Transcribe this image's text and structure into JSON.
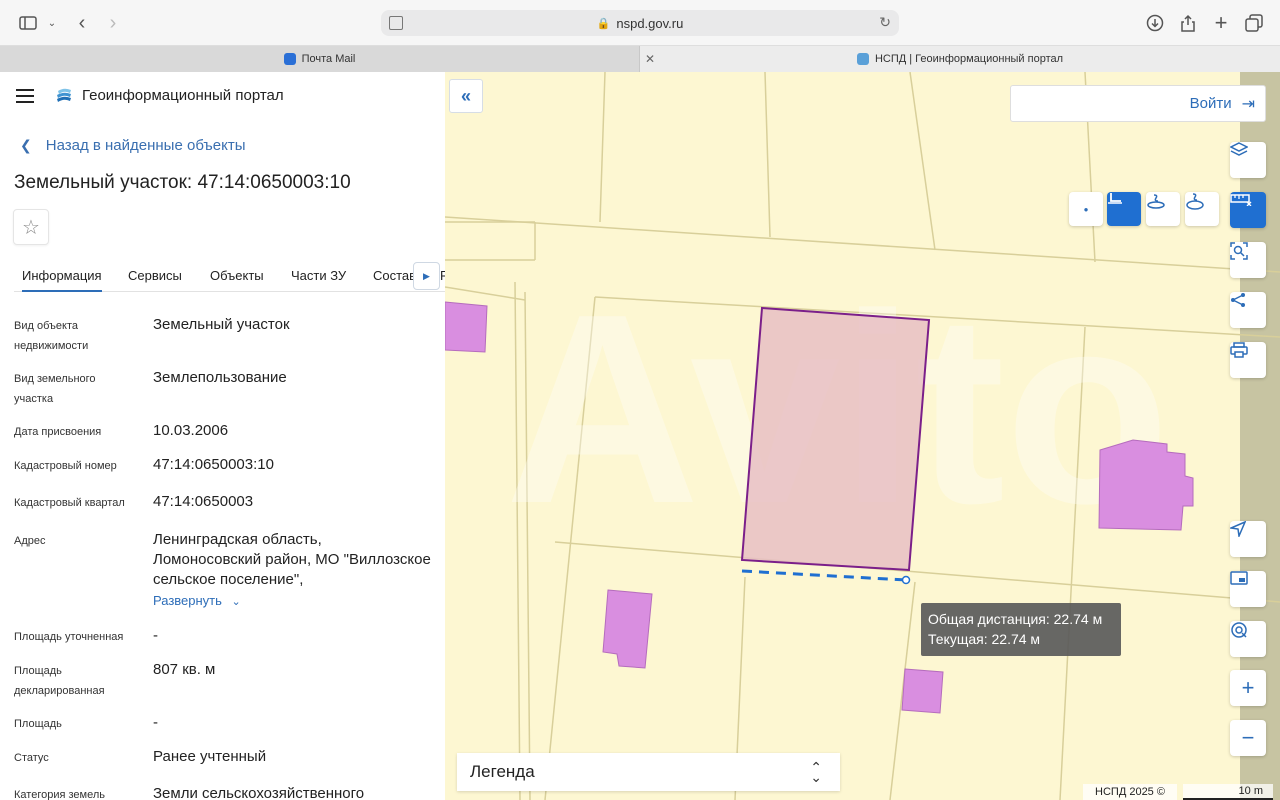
{
  "browser": {
    "url": "nspd.gov.ru",
    "tabs": [
      {
        "label": "Почта Mail"
      },
      {
        "label": "НСПД | Геоинформационный портал"
      }
    ]
  },
  "panel": {
    "portal_title": "Геоинформационный портал",
    "back_label": "Назад в найденные объекты",
    "object_title": "Земельный участок: 47:14:0650003:10",
    "tabs": [
      "Информация",
      "Сервисы",
      "Объекты",
      "Части ЗУ",
      "Состав",
      "Р"
    ],
    "properties": [
      {
        "label": "Вид объекта недвижимости",
        "value": "Земельный участок"
      },
      {
        "label": "Вид земельного участка",
        "value": "Землепользование"
      },
      {
        "label": "Дата присвоения",
        "value": "10.03.2006"
      },
      {
        "label": "Кадастровый номер",
        "value": "47:14:0650003:10"
      },
      {
        "label": "Кадастровый квартал",
        "value": "47:14:0650003"
      },
      {
        "label": "Адрес",
        "value": "Ленинградская область, Ломоносовский район, МО \"Виллозское сельское поселение\","
      },
      {
        "label": "Площадь уточненная",
        "value": "-"
      },
      {
        "label": "Площадь декларированная",
        "value": "807 кв. м"
      },
      {
        "label": "Площадь",
        "value": "-"
      },
      {
        "label": "Статус",
        "value": "Ранее учтенный"
      },
      {
        "label": "Категория земель",
        "value": "Земли сельскохозяйственного"
      }
    ],
    "expand_label": "Развернуть"
  },
  "map": {
    "login_label": "Войти",
    "tooltip": {
      "total": "Общая дистанция: 22.74 м",
      "current": "Текущая: 22.74 м"
    },
    "legend_label": "Легенда",
    "copyright": "НСПД 2025 ©",
    "scale_label": "10 m",
    "watermark": "Avito",
    "colors": {
      "background": "#fdf7d2",
      "parcel_fill": "#e8bfc4",
      "parcel_stroke": "#7b1f8a",
      "building": "#d98ee0",
      "measure_line": "#1f6fd1",
      "accent": "#2d6db8"
    }
  }
}
